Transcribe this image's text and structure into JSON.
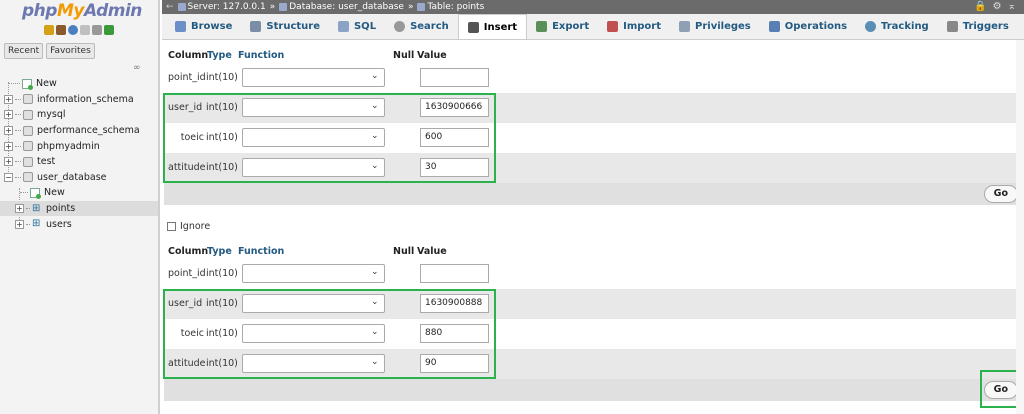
{
  "nav": {
    "logo": {
      "php": "php",
      "my": "My",
      "admin": "Admin"
    },
    "tabs": [
      "Recent",
      "Favorites"
    ],
    "tree": [
      {
        "label": "New",
        "kind": "new",
        "level": 0
      },
      {
        "label": "information_schema",
        "kind": "db",
        "level": 0
      },
      {
        "label": "mysql",
        "kind": "db",
        "level": 0
      },
      {
        "label": "performance_schema",
        "kind": "db",
        "level": 0
      },
      {
        "label": "phpmyadmin",
        "kind": "db",
        "level": 0
      },
      {
        "label": "test",
        "kind": "db",
        "level": 0
      },
      {
        "label": "user_database",
        "kind": "db",
        "level": 0,
        "expanded": true
      },
      {
        "label": "New",
        "kind": "new",
        "level": 1
      },
      {
        "label": "points",
        "kind": "table",
        "level": 1,
        "selected": true
      },
      {
        "label": "users",
        "kind": "table",
        "level": 1
      }
    ]
  },
  "breadcrumb": {
    "server": "Server: 127.0.0.1",
    "database": "Database: user_database",
    "table": "Table: points",
    "separator": "»"
  },
  "menu": {
    "tabs": [
      {
        "label": "Browse",
        "icon": "browse-icon",
        "color": "#6b8fc7"
      },
      {
        "label": "Structure",
        "icon": "structure-icon",
        "color": "#7a8fa6"
      },
      {
        "label": "SQL",
        "icon": "sql-icon",
        "color": "#8aa3c6"
      },
      {
        "label": "Search",
        "icon": "search-icon",
        "color": "#999999"
      },
      {
        "label": "Insert",
        "icon": "insert-icon",
        "color": "#555555",
        "active": true
      },
      {
        "label": "Export",
        "icon": "export-icon",
        "color": "#5a8f5a"
      },
      {
        "label": "Import",
        "icon": "import-icon",
        "color": "#c05050"
      },
      {
        "label": "Privileges",
        "icon": "privileges-icon",
        "color": "#8fa0b5"
      },
      {
        "label": "Operations",
        "icon": "operations-icon",
        "color": "#5a7fb5"
      },
      {
        "label": "Tracking",
        "icon": "tracking-icon",
        "color": "#5a8fb5"
      },
      {
        "label": "Triggers",
        "icon": "triggers-icon",
        "color": "#888888"
      }
    ]
  },
  "insert": {
    "headers": {
      "column": "Column",
      "type": "Type",
      "function": "Function",
      "null": "Null",
      "value": "Value"
    },
    "ignore_label": "Ignore",
    "go_label": "Go",
    "rows1": [
      {
        "column": "point_id",
        "type": "int(10)",
        "value": ""
      },
      {
        "column": "user_id",
        "type": "int(10)",
        "value": "1630900666"
      },
      {
        "column": "toeic",
        "type": "int(10)",
        "value": "600"
      },
      {
        "column": "attitude",
        "type": "int(10)",
        "value": "30"
      }
    ],
    "rows2": [
      {
        "column": "point_id",
        "type": "int(10)",
        "value": ""
      },
      {
        "column": "user_id",
        "type": "int(10)",
        "value": "1630900888"
      },
      {
        "column": "toeic",
        "type": "int(10)",
        "value": "880"
      },
      {
        "column": "attitude",
        "type": "int(10)",
        "value": "90"
      }
    ]
  },
  "highlight_color": "#2bb24c"
}
